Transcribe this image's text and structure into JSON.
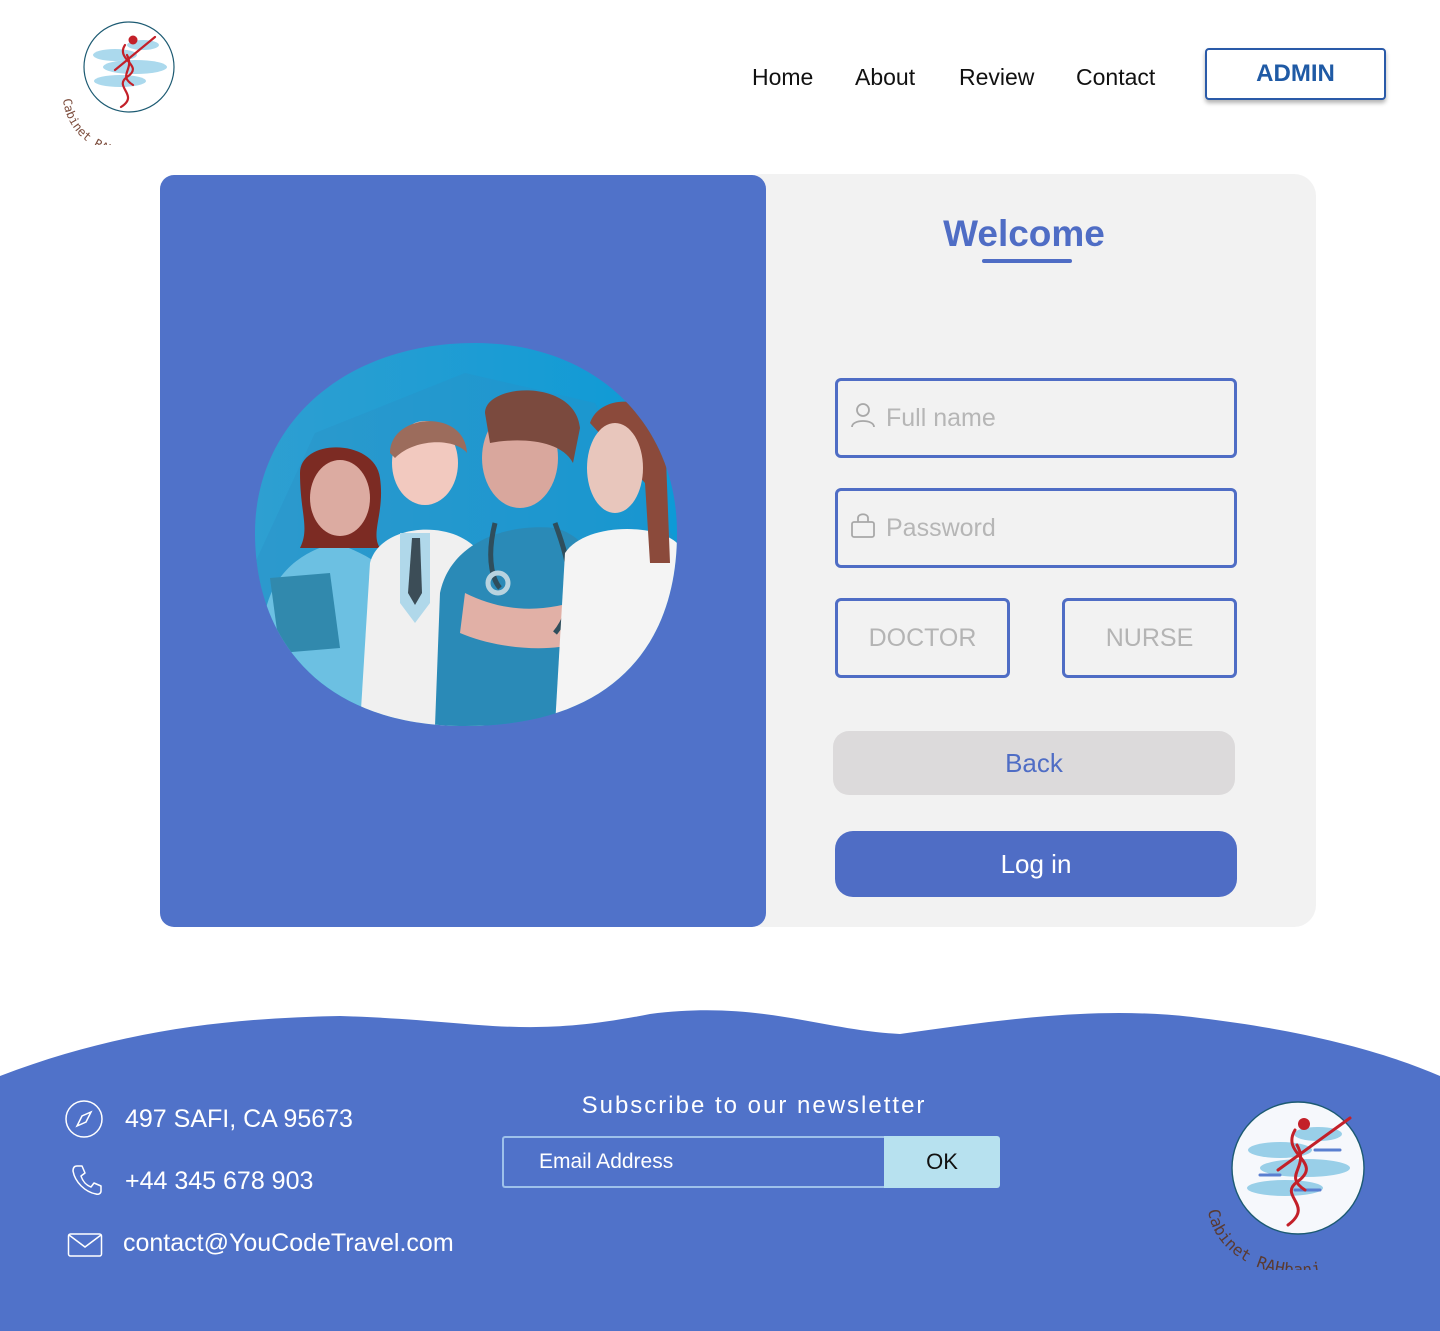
{
  "header": {
    "logo_text": "Cabinet RAHbani",
    "nav": [
      "Home",
      "About",
      "Review",
      "Contact"
    ],
    "admin_label": "ADMIN"
  },
  "login": {
    "welcome": "Welcome",
    "fullname_placeholder": "Full name",
    "password_placeholder": "Password",
    "roles": [
      "DOCTOR",
      "NURSE"
    ],
    "back_label": "Back",
    "login_label": "Log in"
  },
  "footer": {
    "address": "497  SAFI, CA 95673",
    "phone": "+44 345 678 903",
    "email": "contact@YouCodeTravel.com",
    "newsletter_title": "Subscribe to our newsletter",
    "email_placeholder": "Email Address",
    "ok_label": "OK"
  },
  "colors": {
    "primary": "#5072c9",
    "panel": "#f2f2f2",
    "admin_blue": "#1f5aa5",
    "ok_button": "#b7e1ef",
    "back_button": "#dcdadb"
  },
  "icons": [
    "compass-icon",
    "phone-icon",
    "mail-icon",
    "user-icon",
    "lock-icon"
  ]
}
